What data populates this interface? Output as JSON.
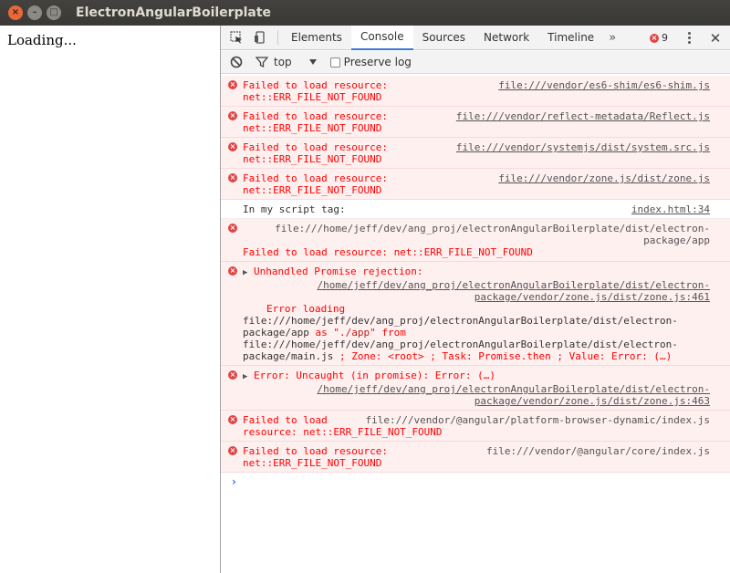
{
  "window": {
    "title": "ElectronAngularBoilerplate",
    "close_glyph": "×",
    "min_glyph": "–",
    "max_glyph": "□"
  },
  "page": {
    "loading_text": "Loading..."
  },
  "devtools": {
    "tabs": [
      {
        "label": "Elements"
      },
      {
        "label": "Console"
      },
      {
        "label": "Sources"
      },
      {
        "label": "Network"
      },
      {
        "label": "Timeline"
      }
    ],
    "more_tabs_glyph": "»",
    "error_count": "9",
    "close_glyph": "✕",
    "active_tab": "Console",
    "accent_color": "#3879d9",
    "error_color": "#ff0000"
  },
  "toolbar": {
    "context": "top",
    "preserve_log_label": "Preserve log"
  },
  "console": {
    "messages": [
      {
        "line1": "Failed to load resource:",
        "source": "file:///vendor/es6-shim/es6-shim.js",
        "line2": "net::ERR_FILE_NOT_FOUND"
      },
      {
        "line1": "Failed to load resource:",
        "source": "file:///vendor/reflect-metadata/Reflect.js",
        "line2": "net::ERR_FILE_NOT_FOUND"
      },
      {
        "line1": "Failed to load resource:",
        "source": "file:///vendor/systemjs/dist/system.src.js",
        "line2": "net::ERR_FILE_NOT_FOUND"
      },
      {
        "line1": "Failed to load resource:",
        "source": "file:///vendor/zone.js/dist/zone.js",
        "line2": "net::ERR_FILE_NOT_FOUND"
      }
    ],
    "log": {
      "text": "In my script tag:",
      "source": "index.html:34"
    },
    "app_error": {
      "path_line1": "file:///home/jeff/dev/ang_proj/electronAngularBoilerplate/dist/electron-",
      "path_line2": "package/app",
      "text": "Failed to load resource: net::ERR_FILE_NOT_FOUND"
    },
    "rejection": {
      "title": "Unhandled Promise rejection:",
      "src1": "/home/jeff/dev/ang_proj/electronAngularBoilerplate/dist/electron-",
      "src2": "package/vendor/zone.js/dist/zone.js:461",
      "l1": "Error loading",
      "l2": "file:///home/jeff/dev/ang_proj/electronAngularBoilerplate/dist/electron-",
      "l3a": "package/app",
      "l3b": " as ",
      "l3c": "\"./app\"",
      "l3d": " from",
      "l4": "file:///home/jeff/dev/ang_proj/electronAngularBoilerplate/dist/electron-",
      "l5a": "package/main.js",
      "l5b": " ; Zone: <root> ; Task: Promise.then ; Value: Error: (…)"
    },
    "uncaught": {
      "title": "Error: Uncaught (in promise): Error: (…)",
      "src1": "/home/jeff/dev/ang_proj/electronAngularBoilerplate/dist/electron-",
      "src2": "package/vendor/zone.js/dist/zone.js:463"
    },
    "platform": {
      "line1": "Failed to load",
      "source": "file:///vendor/@angular/platform-browser-dynamic/index.js",
      "line2": "resource: net::ERR_FILE_NOT_FOUND"
    },
    "core": {
      "line1": "Failed to load resource:",
      "source": "file:///vendor/@angular/core/index.js",
      "line2": "net::ERR_FILE_NOT_FOUND"
    },
    "prompt_glyph": "›",
    "expand_glyph": "▶"
  }
}
